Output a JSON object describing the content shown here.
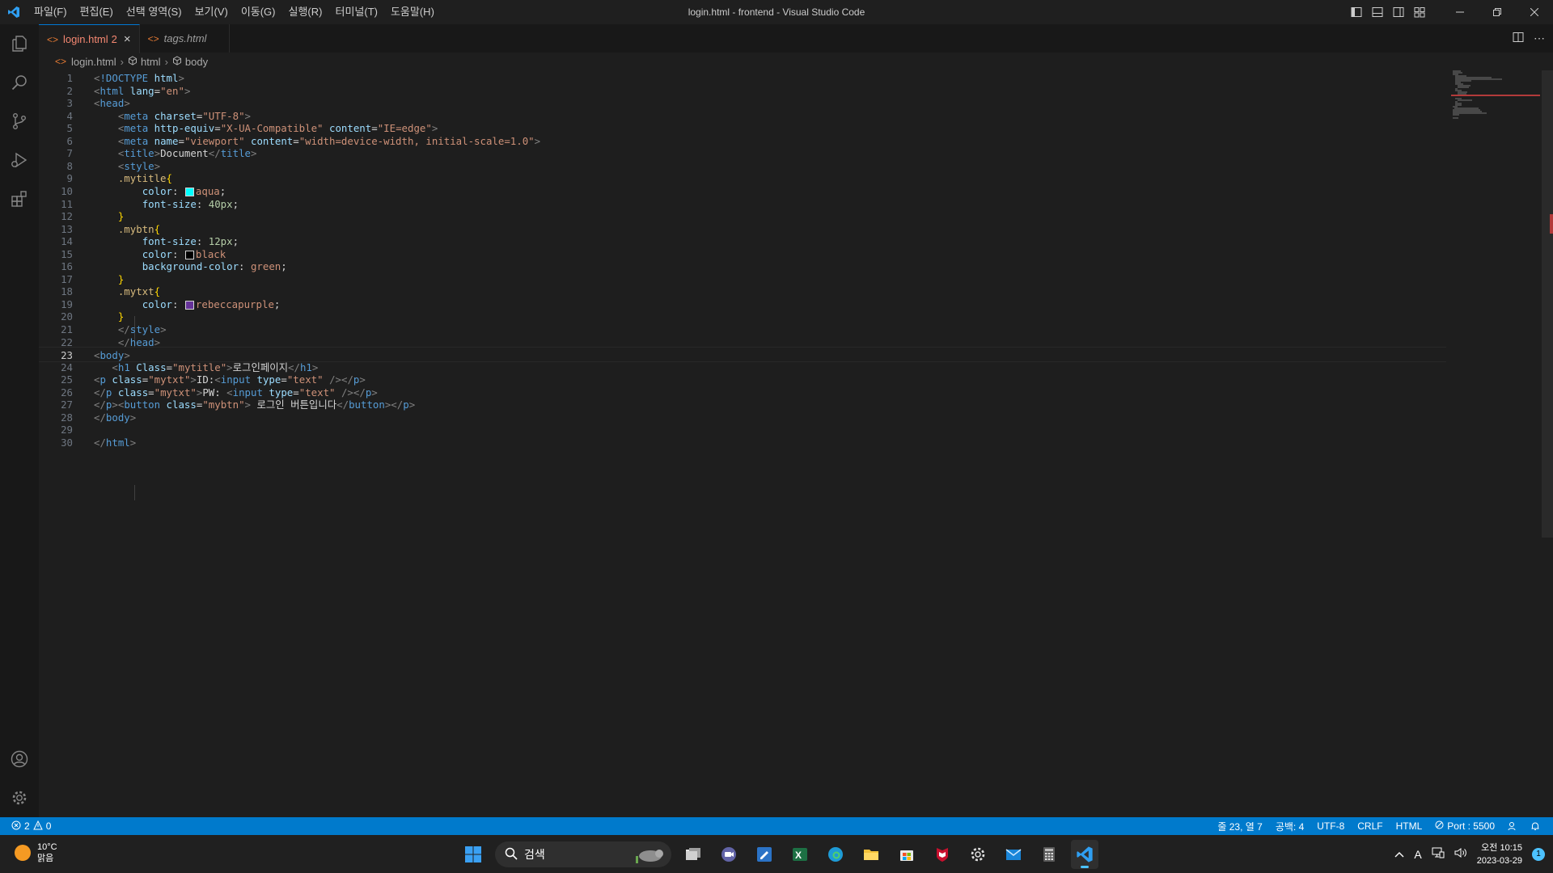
{
  "window": {
    "title": "login.html - frontend - Visual Studio Code",
    "menu": [
      "파일(F)",
      "편집(E)",
      "선택 영역(S)",
      "보기(V)",
      "이동(G)",
      "실행(R)",
      "터미널(T)",
      "도움말(H)"
    ]
  },
  "tabs": [
    {
      "label": "login.html",
      "badge": "2",
      "active": true,
      "close": "×"
    },
    {
      "label": "tags.html",
      "active": false
    }
  ],
  "breadcrumb": [
    "login.html",
    "html",
    "body"
  ],
  "editor": {
    "current_line": 23,
    "lines": [
      [
        [
          "t-tag",
          "<"
        ],
        [
          "t-name",
          "!DOCTYPE"
        ],
        [
          "t-text",
          " "
        ],
        [
          "t-attr",
          "html"
        ],
        [
          "t-tag",
          ">"
        ]
      ],
      [
        [
          "t-tag",
          "<"
        ],
        [
          "t-name",
          "html"
        ],
        [
          "t-text",
          " "
        ],
        [
          "t-attr",
          "lang"
        ],
        [
          "t-text",
          "="
        ],
        [
          "t-str",
          "\"en\""
        ],
        [
          "t-tag",
          ">"
        ]
      ],
      [
        [
          "t-tag",
          "<"
        ],
        [
          "t-name",
          "head"
        ],
        [
          "t-tag",
          ">"
        ]
      ],
      [
        [
          "t-text",
          "    "
        ],
        [
          "t-tag",
          "<"
        ],
        [
          "t-name",
          "meta"
        ],
        [
          "t-text",
          " "
        ],
        [
          "t-attr",
          "charset"
        ],
        [
          "t-text",
          "="
        ],
        [
          "t-str",
          "\"UTF-8\""
        ],
        [
          "t-tag",
          ">"
        ]
      ],
      [
        [
          "t-text",
          "    "
        ],
        [
          "t-tag",
          "<"
        ],
        [
          "t-name",
          "meta"
        ],
        [
          "t-text",
          " "
        ],
        [
          "t-attr",
          "http-equiv"
        ],
        [
          "t-text",
          "="
        ],
        [
          "t-str",
          "\"X-UA-Compatible\""
        ],
        [
          "t-text",
          " "
        ],
        [
          "t-attr",
          "content"
        ],
        [
          "t-text",
          "="
        ],
        [
          "t-str",
          "\"IE=edge\""
        ],
        [
          "t-tag",
          ">"
        ]
      ],
      [
        [
          "t-text",
          "    "
        ],
        [
          "t-tag",
          "<"
        ],
        [
          "t-name",
          "meta"
        ],
        [
          "t-text",
          " "
        ],
        [
          "t-attr",
          "name"
        ],
        [
          "t-text",
          "="
        ],
        [
          "t-str",
          "\"viewport\""
        ],
        [
          "t-text",
          " "
        ],
        [
          "t-attr",
          "content"
        ],
        [
          "t-text",
          "="
        ],
        [
          "t-str",
          "\"width=device-width, initial-scale=1.0\""
        ],
        [
          "t-tag",
          ">"
        ]
      ],
      [
        [
          "t-text",
          "    "
        ],
        [
          "t-tag",
          "<"
        ],
        [
          "t-name",
          "title"
        ],
        [
          "t-tag",
          ">"
        ],
        [
          "t-text",
          "Document"
        ],
        [
          "t-tag",
          "</"
        ],
        [
          "t-name",
          "title"
        ],
        [
          "t-tag",
          ">"
        ]
      ],
      [
        [
          "t-text",
          "    "
        ],
        [
          "t-tag",
          "<"
        ],
        [
          "t-name",
          "style"
        ],
        [
          "t-tag",
          ">"
        ]
      ],
      [
        [
          "t-text",
          "    "
        ],
        [
          "t-sel",
          ".mytitle"
        ],
        [
          "t-brace",
          "{"
        ]
      ],
      [
        [
          "t-text",
          "        "
        ],
        [
          "t-prop",
          "color"
        ],
        [
          "t-text",
          ": "
        ],
        [
          "swatch",
          "#00ffff"
        ],
        [
          "t-str",
          "aqua"
        ],
        [
          "t-text",
          ";"
        ]
      ],
      [
        [
          "t-text",
          "        "
        ],
        [
          "t-prop",
          "font-size"
        ],
        [
          "t-text",
          ": "
        ],
        [
          "t-num",
          "40px"
        ],
        [
          "t-text",
          ";"
        ]
      ],
      [
        [
          "t-text",
          "    "
        ],
        [
          "t-brace",
          "}"
        ]
      ],
      [
        [
          "t-text",
          "    "
        ],
        [
          "t-sel",
          ".mybtn"
        ],
        [
          "t-brace",
          "{"
        ]
      ],
      [
        [
          "t-text",
          "        "
        ],
        [
          "t-prop",
          "font-size"
        ],
        [
          "t-text",
          ": "
        ],
        [
          "t-num",
          "12px"
        ],
        [
          "t-text",
          ";"
        ]
      ],
      [
        [
          "t-text",
          "        "
        ],
        [
          "t-prop",
          "color"
        ],
        [
          "t-text",
          ": "
        ],
        [
          "swatch",
          "#000000"
        ],
        [
          "t-str",
          "black"
        ]
      ],
      [
        [
          "t-text",
          "        "
        ],
        [
          "t-prop",
          "background-color"
        ],
        [
          "t-text",
          ": "
        ],
        [
          "t-str",
          "green"
        ],
        [
          "t-text",
          ";"
        ]
      ],
      [
        [
          "t-text",
          "    "
        ],
        [
          "t-brace",
          "}"
        ]
      ],
      [
        [
          "t-text",
          "    "
        ],
        [
          "t-sel",
          ".mytxt"
        ],
        [
          "t-brace",
          "{"
        ]
      ],
      [
        [
          "t-text",
          "        "
        ],
        [
          "t-prop",
          "color"
        ],
        [
          "t-text",
          ": "
        ],
        [
          "swatch",
          "#663399"
        ],
        [
          "t-str",
          "rebeccapurple"
        ],
        [
          "t-text",
          ";"
        ]
      ],
      [
        [
          "t-text",
          "    "
        ],
        [
          "t-brace",
          "}"
        ]
      ],
      [
        [
          "t-text",
          "    "
        ],
        [
          "t-tag",
          "</"
        ],
        [
          "t-name",
          "style"
        ],
        [
          "t-tag",
          ">"
        ]
      ],
      [
        [
          "t-text",
          "    "
        ],
        [
          "t-tag",
          "</"
        ],
        [
          "t-name",
          "head"
        ],
        [
          "t-tag",
          ">"
        ]
      ],
      [
        [
          "t-tag",
          "<"
        ],
        [
          "t-name",
          "body"
        ],
        [
          "t-tag",
          ">"
        ]
      ],
      [
        [
          "t-text",
          "   "
        ],
        [
          "t-tag",
          "<"
        ],
        [
          "t-name",
          "h1"
        ],
        [
          "t-text",
          " "
        ],
        [
          "t-attr",
          "Class"
        ],
        [
          "t-text",
          "="
        ],
        [
          "t-str",
          "\"mytitle\""
        ],
        [
          "t-tag",
          ">"
        ],
        [
          "t-text",
          "로그인페이지"
        ],
        [
          "t-tag",
          "</"
        ],
        [
          "t-name",
          "h1"
        ],
        [
          "t-tag",
          ">"
        ]
      ],
      [
        [
          "t-tag",
          "<"
        ],
        [
          "t-name",
          "p"
        ],
        [
          "t-text",
          " "
        ],
        [
          "t-attr",
          "class"
        ],
        [
          "t-text",
          "="
        ],
        [
          "t-str",
          "\"mytxt\""
        ],
        [
          "t-tag",
          ">"
        ],
        [
          "t-text",
          "ID:"
        ],
        [
          "t-tag",
          "<"
        ],
        [
          "t-name",
          "input"
        ],
        [
          "t-text",
          " "
        ],
        [
          "t-attr",
          "type"
        ],
        [
          "t-text",
          "="
        ],
        [
          "t-str",
          "\"text\""
        ],
        [
          "t-text",
          " "
        ],
        [
          "t-tag",
          "/></"
        ],
        [
          "t-name",
          "p"
        ],
        [
          "t-tag",
          ">"
        ]
      ],
      [
        [
          "t-tag",
          "</"
        ],
        [
          "t-name",
          "p"
        ],
        [
          "t-text",
          " "
        ],
        [
          "t-attr",
          "class"
        ],
        [
          "t-text",
          "="
        ],
        [
          "t-str",
          "\"mytxt\""
        ],
        [
          "t-tag",
          ">"
        ],
        [
          "t-text",
          "PW: "
        ],
        [
          "t-tag",
          "<"
        ],
        [
          "t-name",
          "input"
        ],
        [
          "t-text",
          " "
        ],
        [
          "t-attr",
          "type"
        ],
        [
          "t-text",
          "="
        ],
        [
          "t-str",
          "\"text\""
        ],
        [
          "t-text",
          " "
        ],
        [
          "t-tag",
          "/></"
        ],
        [
          "t-name",
          "p"
        ],
        [
          "t-tag",
          ">"
        ]
      ],
      [
        [
          "t-tag",
          "</"
        ],
        [
          "t-name",
          "p"
        ],
        [
          "t-tag",
          "><"
        ],
        [
          "t-name",
          "button"
        ],
        [
          "t-text",
          " "
        ],
        [
          "t-attr",
          "class"
        ],
        [
          "t-text",
          "="
        ],
        [
          "t-str",
          "\"mybtn\""
        ],
        [
          "t-tag",
          ">"
        ],
        [
          "t-text",
          " 로그인 버튼입니다"
        ],
        [
          "t-tag",
          "</"
        ],
        [
          "t-name",
          "button"
        ],
        [
          "t-tag",
          "></"
        ],
        [
          "t-name",
          "p"
        ],
        [
          "t-tag",
          ">"
        ]
      ],
      [
        [
          "t-tag",
          "</"
        ],
        [
          "t-name",
          "body"
        ],
        [
          "t-tag",
          ">"
        ]
      ],
      [],
      [
        [
          "t-tag",
          "</"
        ],
        [
          "t-name",
          "html"
        ],
        [
          "t-tag",
          ">"
        ]
      ]
    ]
  },
  "statusbar": {
    "errors": "2",
    "warnings": "0",
    "position": "줄 23, 열 7",
    "spaces": "공백: 4",
    "encoding": "UTF-8",
    "eol": "CRLF",
    "language": "HTML",
    "port": "Port : 5500"
  },
  "taskbar": {
    "weather_temp": "10°C",
    "weather_desc": "맑음",
    "search_placeholder": "검색",
    "time": "오전 10:15",
    "date": "2023-03-29",
    "notifications": "1",
    "ime": "A"
  },
  "colors": {
    "accent": "#007acc",
    "editor_bg": "#1e1e1e",
    "error": "#f14c4c"
  }
}
